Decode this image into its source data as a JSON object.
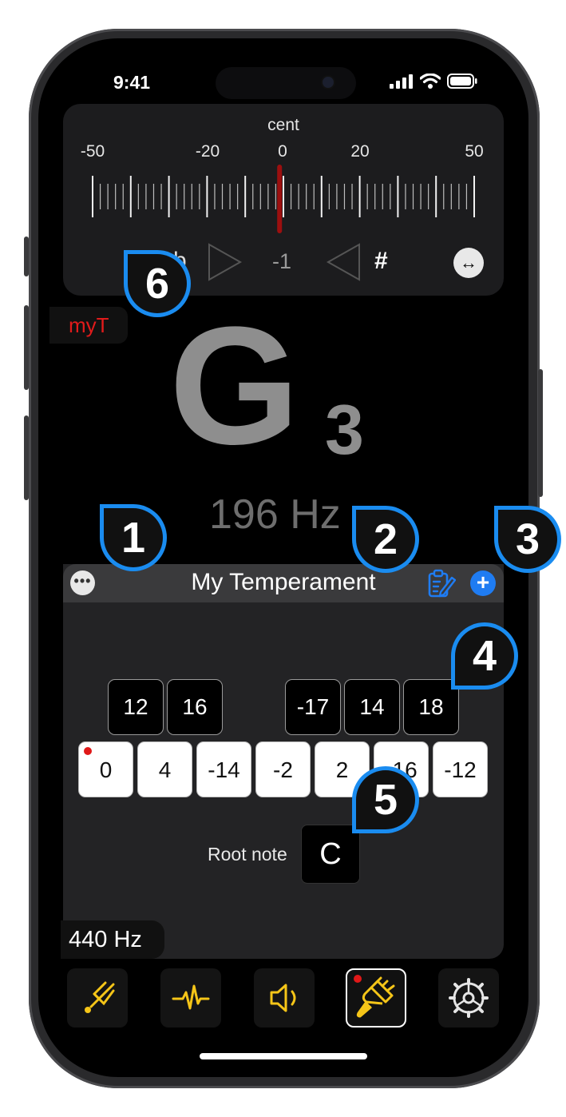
{
  "status_bar": {
    "time": "9:41"
  },
  "meter": {
    "unit": "cent",
    "tick_labels": [
      "-50",
      "-20",
      "0",
      "20",
      "50"
    ],
    "flat_symbol": "b",
    "sharp_symbol": "#",
    "cents_value": "-1",
    "needle_cents": -1,
    "swap_icon": "↔"
  },
  "temperament_tag": "myT",
  "note": {
    "letter": "G",
    "octave": "3",
    "frequency": "196 Hz"
  },
  "panel": {
    "title": "My Temperament",
    "more_icon": "•••",
    "add_icon": "+",
    "black_keys": [
      "12",
      "16",
      "-17",
      "14",
      "18"
    ],
    "white_keys": [
      "0",
      "4",
      "-14",
      "-2",
      "2",
      "-16",
      "-12"
    ],
    "root_label": "Root note",
    "root_value": "C"
  },
  "reference_pitch": "440 Hz",
  "tabs": [
    {
      "name": "tuning-fork-icon"
    },
    {
      "name": "waveform-icon"
    },
    {
      "name": "speaker-icon"
    },
    {
      "name": "brush-icon",
      "active": true
    },
    {
      "name": "settings-icon"
    }
  ],
  "callouts": [
    "1",
    "2",
    "3",
    "4",
    "5",
    "6"
  ],
  "colors": {
    "accent_blue": "#1f7cf2",
    "accent_yellow": "#f5c518",
    "needle_red": "#9c0f0f",
    "tag_red": "#e21b1b"
  }
}
